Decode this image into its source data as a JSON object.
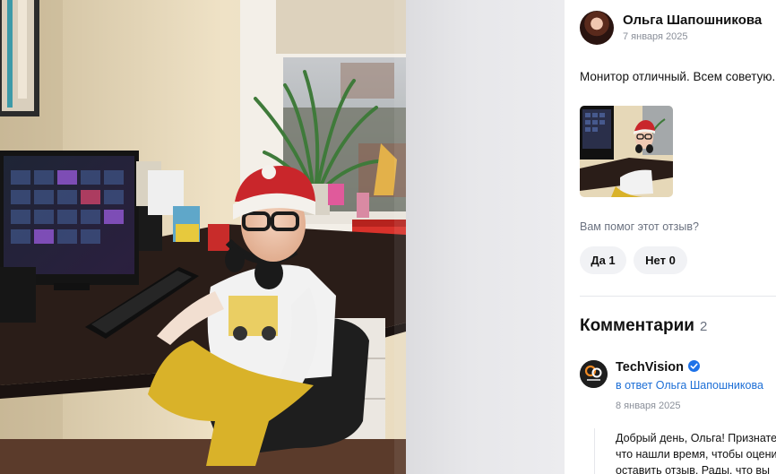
{
  "photo": {
    "alt_icon": "review-photo",
    "monitor_brand_icon": "monitor-icon"
  },
  "review": {
    "author": {
      "name": "Ольга Шапошникова",
      "date": "7 января 2025",
      "avatar_icon": "user-avatar"
    },
    "text": "Монитор отличный. Всем советую.",
    "helpful": {
      "question": "Вам помог этот отзыв?",
      "yes": "Да 1",
      "no": "Нет 0"
    }
  },
  "comments": {
    "title": "Комментарии",
    "count": "2",
    "items": [
      {
        "author": "TechVision",
        "avatar_icon": "techvision-logo",
        "verified_icon": "verified-badge-icon",
        "reply_to": "в ответ Ольга Шапошникова",
        "date": "8 января 2025",
        "text_lines": [
          "Добрый день, Ольга! Признательны,",
          "что нашли время, чтобы оценить",
          "оставить отзыв. Рады, что вы"
        ]
      }
    ]
  },
  "colors": {
    "link": "#1d6fd6",
    "verified": "#1d72e8",
    "muted": "#8a8f99",
    "button_bg": "#f1f2f5"
  }
}
